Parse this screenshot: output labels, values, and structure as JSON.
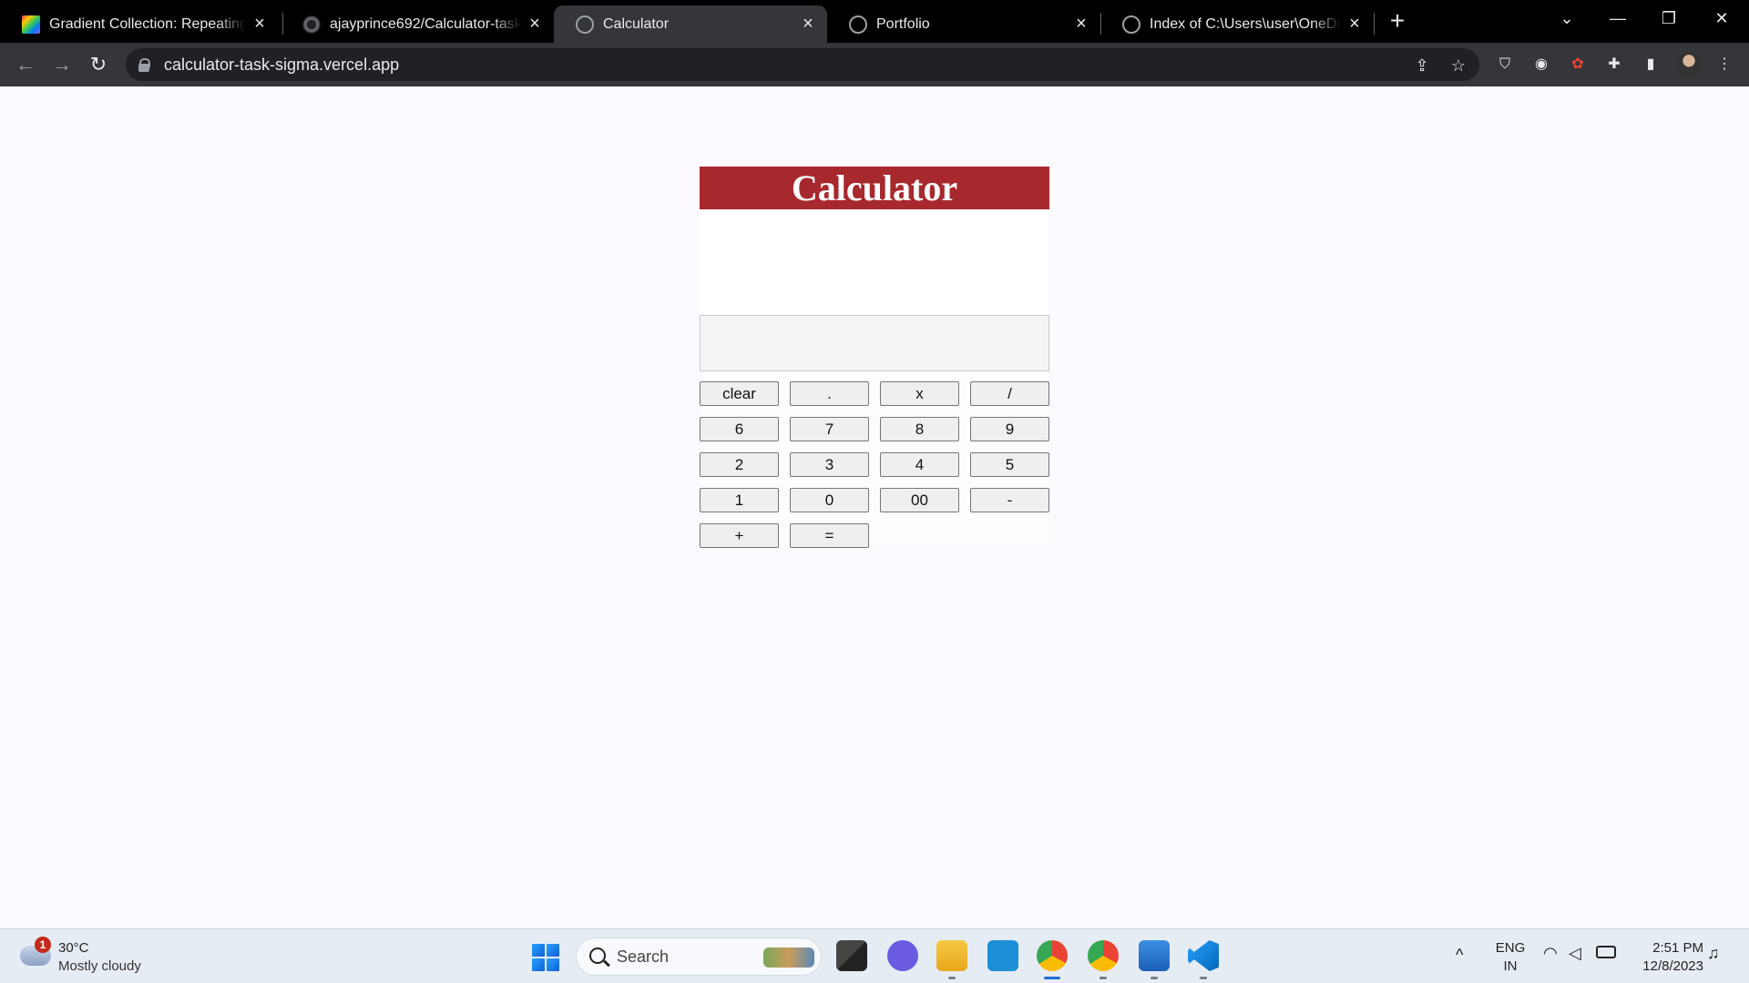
{
  "browser": {
    "tabs": [
      {
        "title": "Gradient Collection: Repeating S",
        "active": false
      },
      {
        "title": "ajayprince692/Calculator-task: D",
        "active": false
      },
      {
        "title": "Calculator",
        "active": true
      },
      {
        "title": "Portfolio",
        "active": false
      },
      {
        "title": "Index of C:\\Users\\user\\OneDrive",
        "active": false
      }
    ],
    "new_tab_label": "+",
    "url": "calculator-task-sigma.vercel.app"
  },
  "calculator": {
    "title": "Calculator",
    "display_value": "",
    "keys": [
      [
        "clear",
        ".",
        "x",
        "/"
      ],
      [
        "6",
        "7",
        "8",
        "9"
      ],
      [
        "2",
        "3",
        "4",
        "5"
      ],
      [
        "1",
        "0",
        "00",
        "-"
      ],
      [
        "+",
        "="
      ]
    ]
  },
  "taskbar": {
    "weather": {
      "badge": "1",
      "temperature": "30°C",
      "condition": "Mostly cloudy"
    },
    "search_placeholder": "Search",
    "language": {
      "line1": "ENG",
      "line2": "IN"
    },
    "clock": {
      "time": "2:51 PM",
      "date": "12/8/2023"
    }
  },
  "colors": {
    "calculator_header": "#a7282d",
    "page_background": "#fcfaff",
    "taskbar_background": "#e6ecf3"
  }
}
